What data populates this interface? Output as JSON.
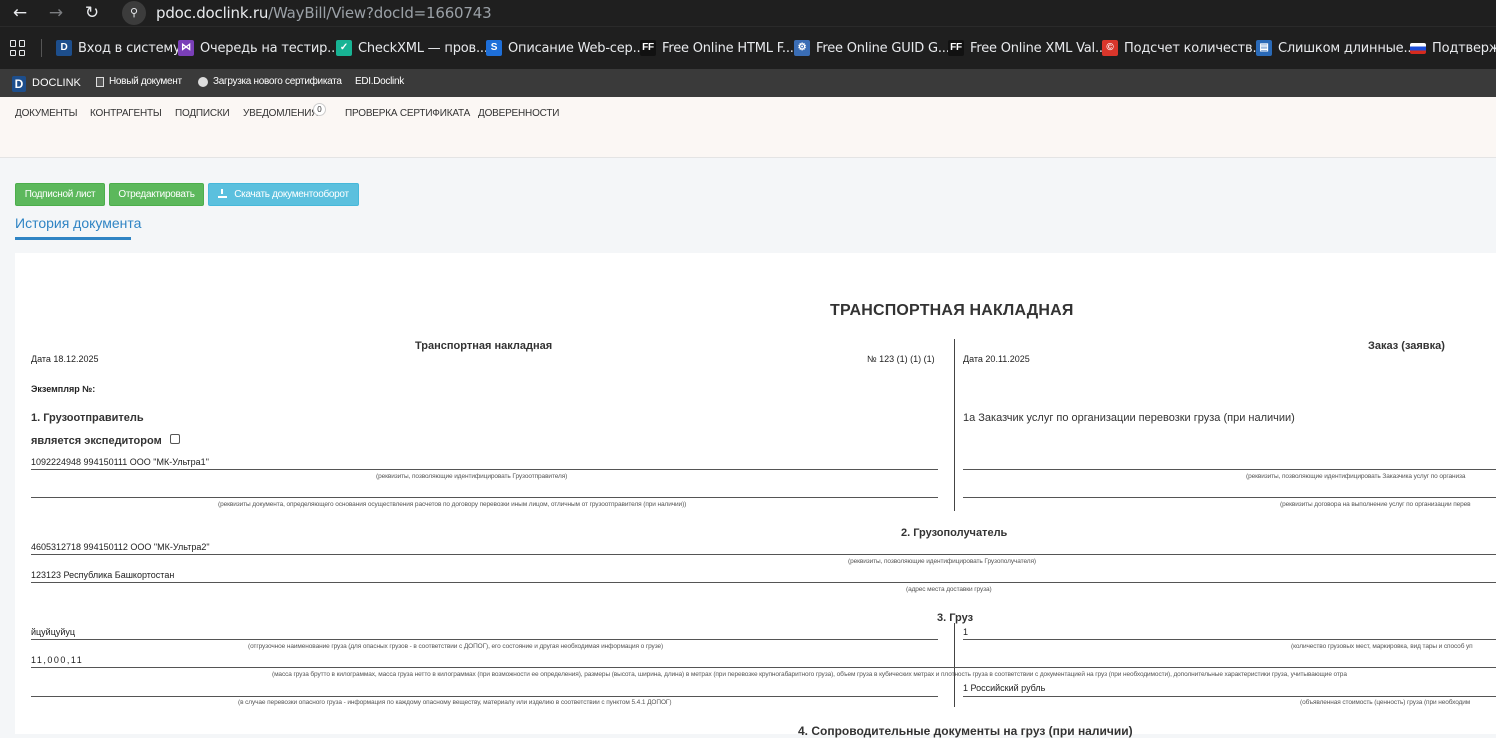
{
  "browser": {
    "url_host": "pdoc.doclink.ru",
    "url_path": "/WayBill/View?docId=1660743",
    "bookmarks": [
      {
        "label": "Вход в систему",
        "icon": "doclink-d-icon",
        "color": "#1d4e8c",
        "glyph": "D"
      },
      {
        "label": "Очередь на тестир...",
        "icon": "visual-studio-icon",
        "color": "#7a3fb8",
        "glyph": "⋈"
      },
      {
        "label": "CheckXML — пров...",
        "icon": "checkxml-icon",
        "color": "#18b394",
        "glyph": "✓"
      },
      {
        "label": "Описание Web-сер...",
        "icon": "web-service-icon",
        "color": "#1e6fd9",
        "glyph": "S"
      },
      {
        "label": "Free Online HTML F...",
        "icon": "freeformatter-icon",
        "color": "#111111",
        "glyph": "FF"
      },
      {
        "label": "Free Online GUID G...",
        "icon": "gears-icon",
        "color": "#3a6db5",
        "glyph": "⚙"
      },
      {
        "label": "Free Online XML Val...",
        "icon": "freeformatter-icon",
        "color": "#111111",
        "glyph": "FF"
      },
      {
        "label": "Подсчет количеств...",
        "icon": "copyright-icon",
        "color": "#d9362b",
        "glyph": "©"
      },
      {
        "label": "Слишком длинные...",
        "icon": "page-icon",
        "color": "#2a6ab8",
        "glyph": "▤"
      },
      {
        "label": "Подтвержд",
        "icon": "russia-flag-icon",
        "color": "#1d4ed8",
        "glyph": ""
      }
    ]
  },
  "app": {
    "logo": "DOCLINK",
    "logo_letter": "D",
    "header_links": [
      "Новый документ",
      "Загрузка нового сертификата",
      "EDI.Doclink"
    ],
    "menu": [
      "ДОКУМЕНТЫ",
      "КОНТРАГЕНТЫ",
      "ПОДПИСКИ",
      "УВЕДОМЛЕНИЯ",
      "ПРОВЕРКА СЕРТИФИКАТА",
      "ДОВЕРЕННОСТИ"
    ],
    "notifications_count": "0",
    "buttons": [
      "Подписной лист",
      "Отредактировать",
      "Скачать документооборот"
    ],
    "history_tab": "История документа"
  },
  "doc": {
    "title": "ТРАНСПОРТНАЯ НАКЛАДНАЯ",
    "left_header": "Транспортная накладная",
    "left_date": "Дата  18.12.2025",
    "number": "№   123 (1) (1) (1)",
    "copy_label": "Экземпляр №:",
    "right_header": "Заказ (заявка)",
    "right_date": "Дата 20.11.2025",
    "s1_title": "1. Грузоотправитель",
    "s1_forwarder": "является экспедитором",
    "s1_value": "1092224948 994150111 ООО \"МК-Ультра1\"",
    "s1_caption1": "(реквизиты, позволяющие идентифицировать Грузоотправителя)",
    "s1_caption2": "(реквизиты документа, определяющего основания осуществления расчетов по договору перевозки иным лицом, отличным от грузоотправителя (при наличии))",
    "s1a_title": "1а Заказчик услуг по организации перевозки груза (при наличии)",
    "s1a_caption1": "(реквизиты, позволяющие идентифицировать Заказчика услуг по организа",
    "s1a_caption2": "(реквизиты договора на выполнение услуг по организации перев",
    "s2_title": "2. Грузополучатель",
    "s2_value1": "4605312718 994150112 ООО \"МК-Ультра2\"",
    "s2_caption1": "(реквизиты, позволяющие идентифицировать Грузополучателя)",
    "s2_value2": "123123 Республика Башкортостан",
    "s2_caption2": "(адрес места доставки груза)",
    "s3_title": "3. Груз",
    "s3_value1": "йцуйцуйуц",
    "s3_caption1": "(отгрузочное наименование груза (для опасных грузов - в соответствии с ДОПОГ), его состояние и другая необходимая информация о грузе)",
    "s3_right1": "1",
    "s3_right_caption1": "(количество грузовых мест, маркировка, вид тары и способ уп",
    "s3_value2": "11,000,11",
    "s3_caption2": "(масса груза брутто в килограммах, масса груза нетто в килограммах (при возможности ее определения), размеры (высота, ширина, длина) в метрах (при перевозке крупногабаритного груза), объем груза в кубических метрах и плотность груза в соответствии с документацией на груз (при необходимости), дополнительные характеристики груза, учитывающие отра",
    "s3_caption3": "(в случае перевозки опасного груза - информация по каждому опасному веществу, материалу или изделию в соответствии с пунктом 5.4.1 ДОПОГ)",
    "s3_right2": "1 Российский рубль",
    "s3_right_caption2": "(объявленная стоимость (ценность) груза (при необходим",
    "s4_title": "4. Сопроводительные документы на груз (при наличии)"
  }
}
